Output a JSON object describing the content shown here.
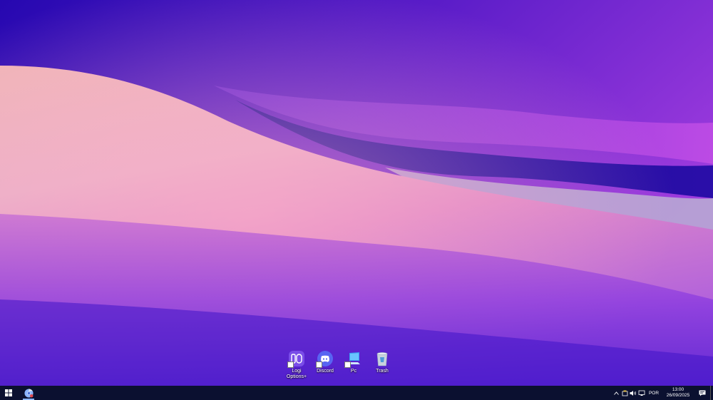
{
  "desktop": {
    "icons": [
      {
        "label": "Logi\nOptions+",
        "icon": "logi-options-icon",
        "shortcut": true
      },
      {
        "label": "Discord",
        "icon": "discord-icon",
        "shortcut": true
      },
      {
        "label": "Pc",
        "icon": "pc-icon",
        "shortcut": true
      },
      {
        "label": "Trash",
        "icon": "recycle-bin-icon",
        "shortcut": false
      }
    ]
  },
  "taskbar": {
    "apps": [
      {
        "icon": "chrome-icon",
        "active": true
      }
    ],
    "tray": {
      "language": "POR",
      "time": "13:00",
      "date": "26/09/2025"
    }
  },
  "colors": {
    "taskbar_bg": "#0b1030",
    "accent": "#8ab4ff"
  }
}
